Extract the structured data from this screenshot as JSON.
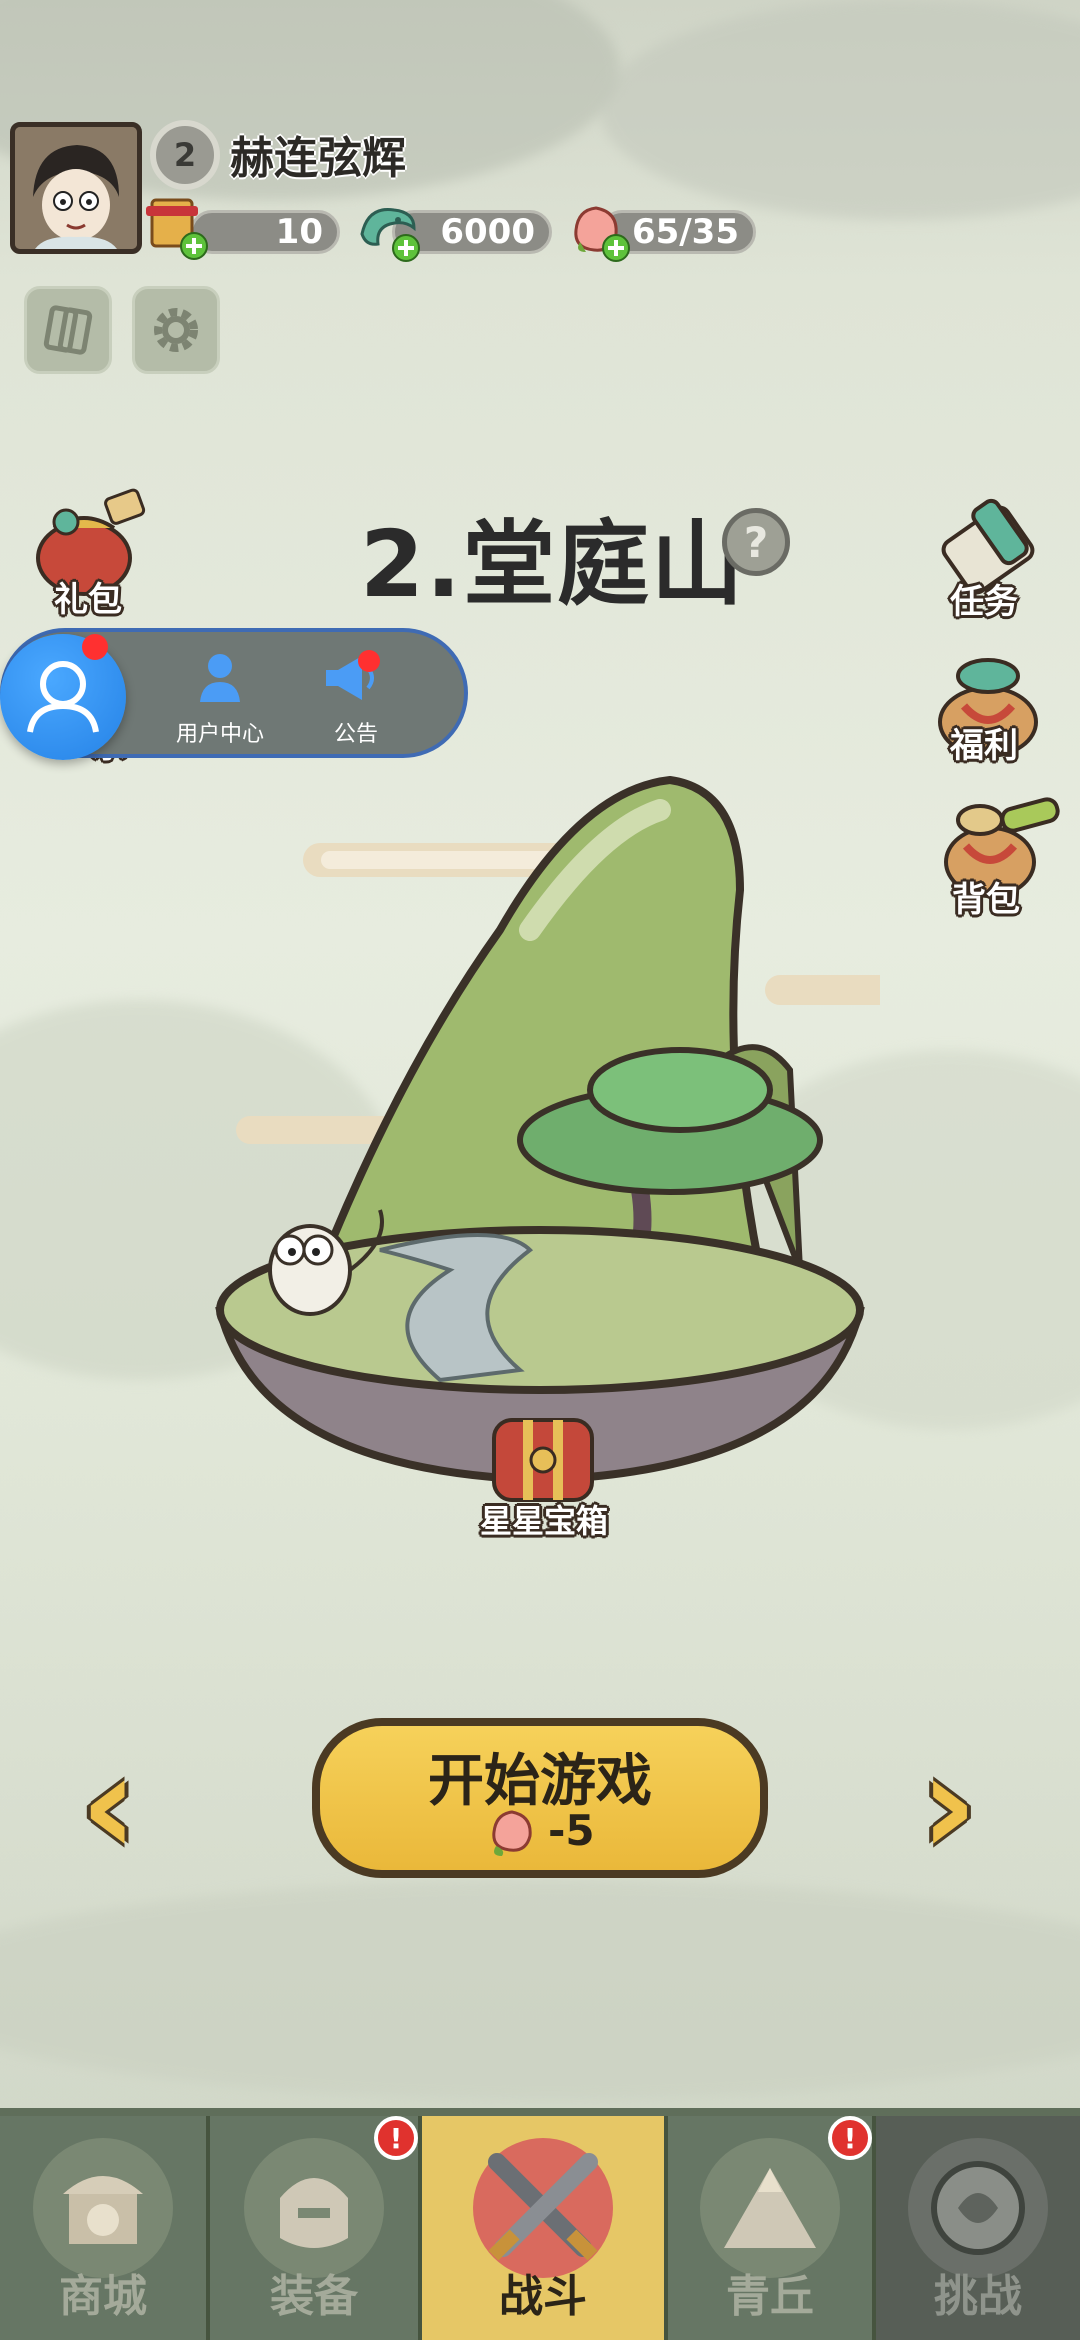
{
  "player": {
    "level": "2",
    "name": "赫连弦辉"
  },
  "resources": {
    "scrolls": "10",
    "jade": "6000",
    "peach": "65/35"
  },
  "stage": {
    "title": "2.堂庭山",
    "help": "?",
    "chest_label": "星星宝箱"
  },
  "left_menu": {
    "gift": "礼包",
    "fun": "乐"
  },
  "right_menu": {
    "task": "任务",
    "welfare": "福利",
    "bag": "背包"
  },
  "float_panel": {
    "user_center": "用户中心",
    "notice": "公告"
  },
  "start": {
    "label": "开始游戏",
    "cost": "-5"
  },
  "nav": {
    "tabs": [
      {
        "label": "商城"
      },
      {
        "label": "装备"
      },
      {
        "label": "战斗"
      },
      {
        "label": "青丘"
      },
      {
        "label": "挑战"
      }
    ],
    "badge": "!"
  }
}
